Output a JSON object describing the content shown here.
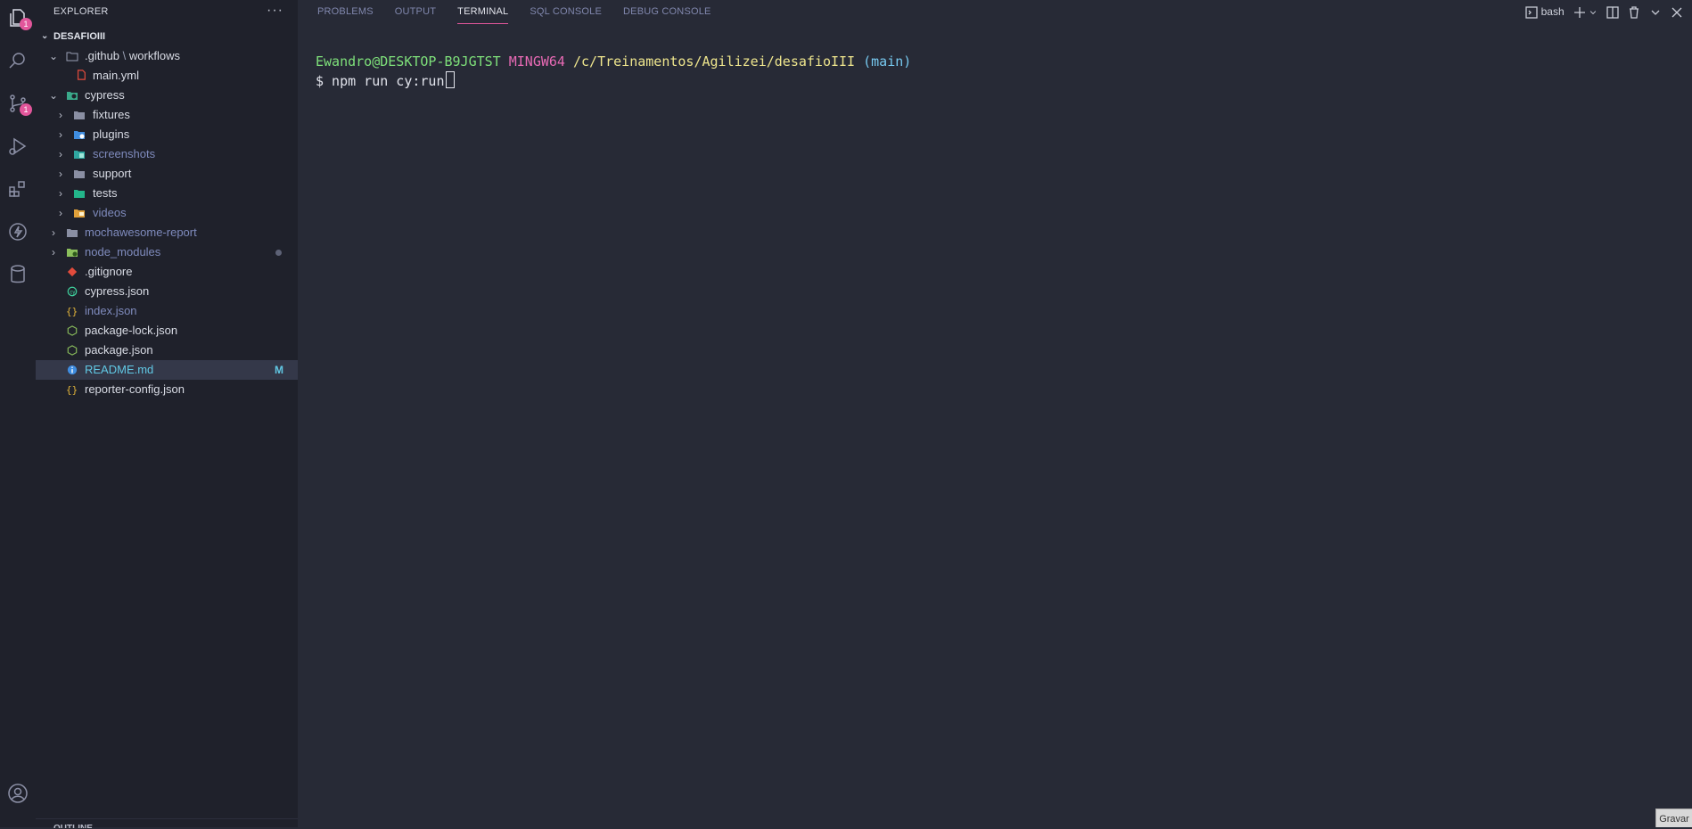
{
  "sidebar": {
    "title": "EXPLORER",
    "more": "···",
    "root": "DESAFIOIII",
    "outline": "OUTLINE",
    "explorer_badge": "1",
    "scm_badge": "1",
    "tree": {
      "github": ".github",
      "github_sep": "\\",
      "workflows": "workflows",
      "main_yml": "main.yml",
      "cypress": "cypress",
      "fixtures": "fixtures",
      "plugins": "plugins",
      "screenshots": "screenshots",
      "support": "support",
      "tests": "tests",
      "videos": "videos",
      "mochawesome": "mochawesome-report",
      "node_modules": "node_modules",
      "gitignore": ".gitignore",
      "cypress_json": "cypress.json",
      "index_json": "index.json",
      "package_lock": "package-lock.json",
      "package_json": "package.json",
      "readme": "README.md",
      "readme_mark": "M",
      "reporter": "reporter-config.json"
    }
  },
  "panel": {
    "tabs": {
      "problems": "PROBLEMS",
      "output": "OUTPUT",
      "terminal": "TERMINAL",
      "sql": "SQL CONSOLE",
      "debug": "DEBUG CONSOLE"
    },
    "shell": "bash",
    "terminal": {
      "user": "Ewandro@DESKTOP-B9JGTST",
      "system": "MINGW64",
      "path": "/c/Treinamentos/Agilizei/desafioIII",
      "branch": "(main)",
      "prompt": "$ npm run cy:run"
    }
  },
  "overlay": {
    "gravar": "Gravar"
  },
  "colors": {
    "accent": "#e2569b",
    "background": "#272a36",
    "sidebar": "#1f212b"
  }
}
